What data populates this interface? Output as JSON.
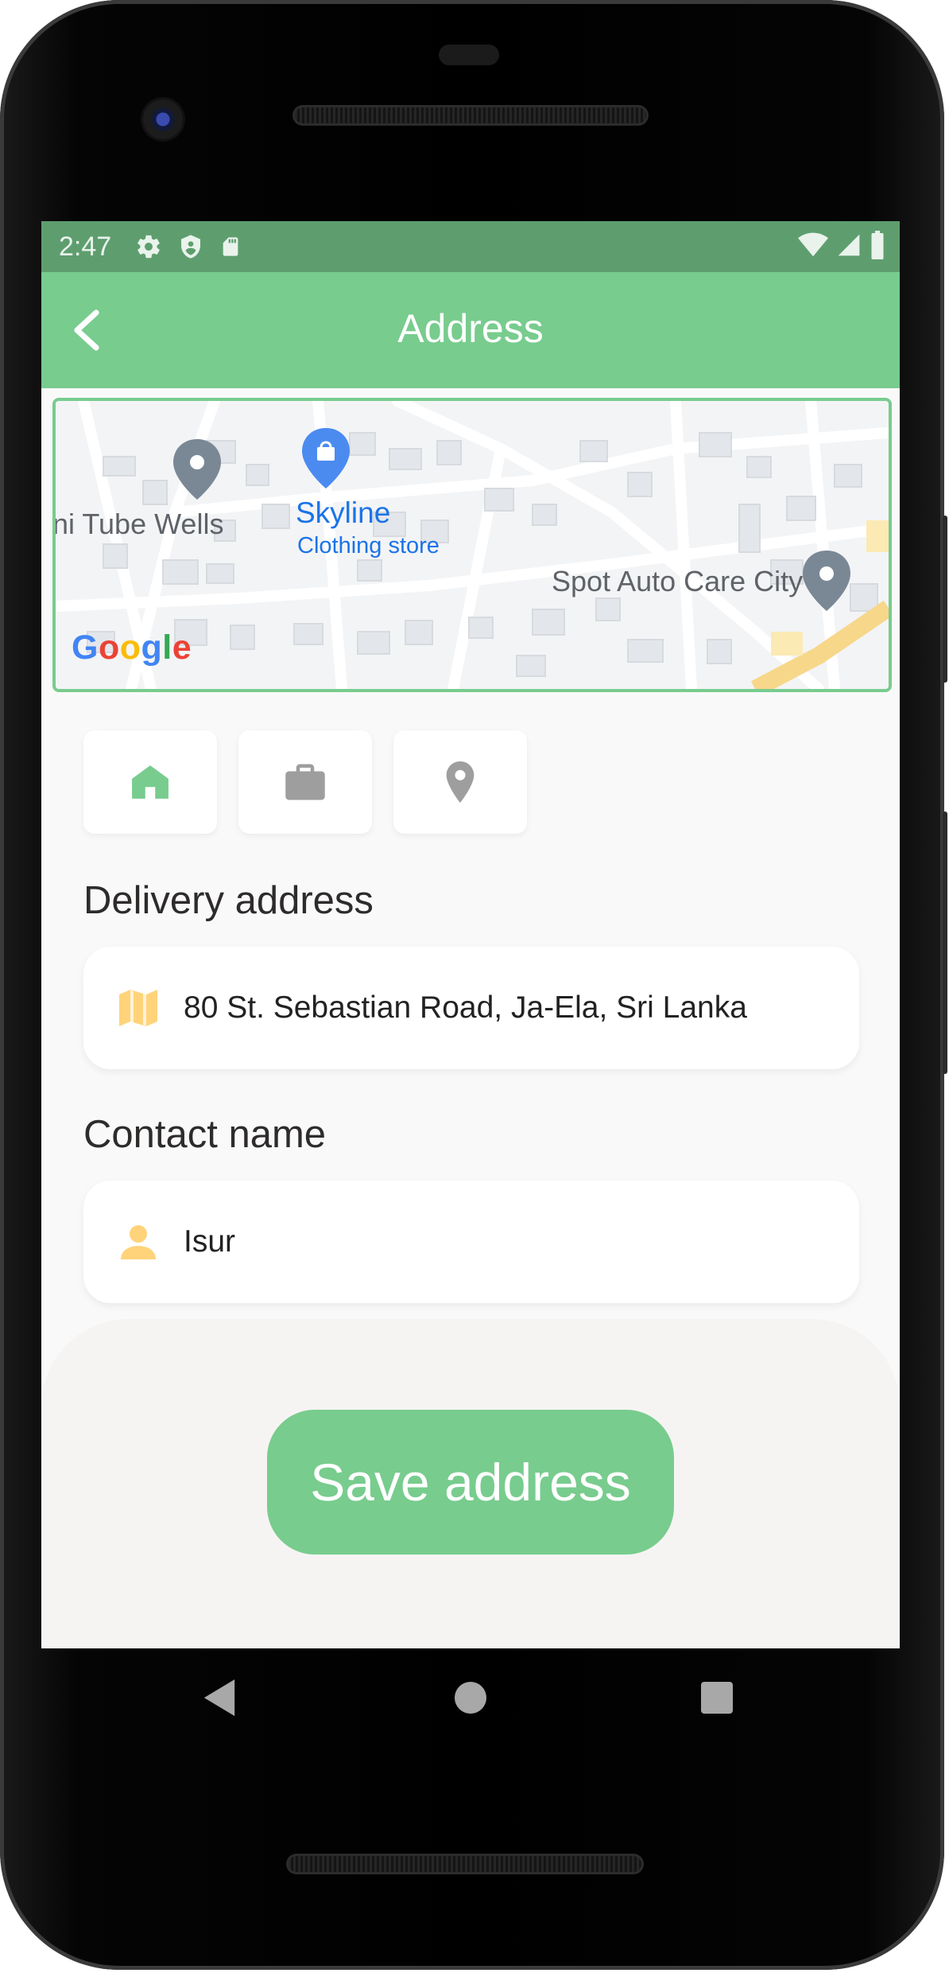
{
  "statusbar": {
    "time": "2:47",
    "left_icons": [
      "gear-icon",
      "shield-icon",
      "sd-card-icon"
    ],
    "right_icons": [
      "wifi-icon",
      "signal-icon",
      "battery-icon"
    ]
  },
  "appbar": {
    "title": "Address",
    "back_icon": "chevron-left-icon"
  },
  "map": {
    "labels": {
      "place1": "ni Tube Wells",
      "place2": "Skyline",
      "place2_sub": "Clothing store",
      "place3": "Spot Auto Care City"
    },
    "attribution": "Google"
  },
  "address_types": [
    {
      "name": "home",
      "icon": "home-icon",
      "selected": true
    },
    {
      "name": "work",
      "icon": "briefcase-icon",
      "selected": false
    },
    {
      "name": "other",
      "icon": "location-pin-icon",
      "selected": false
    }
  ],
  "form": {
    "delivery_label": "Delivery address",
    "delivery_value": "80 St. Sebastian Road, Ja-Ela, Sri Lanka",
    "contact_label": "Contact name",
    "contact_value": "Isur"
  },
  "save_button": {
    "label": "Save address"
  },
  "colors": {
    "primary": "#78cc8e",
    "status_bar": "#5e9e6e",
    "field_icon": "#ffd37a",
    "inactive_icon": "#9e9e9e",
    "background": "#f9f9f9"
  }
}
